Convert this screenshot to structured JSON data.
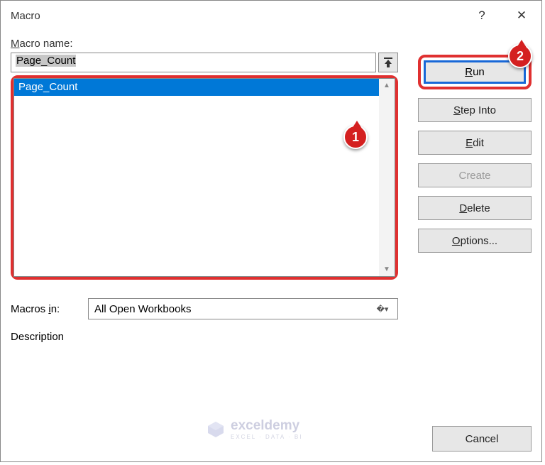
{
  "dialog": {
    "title": "Macro",
    "help_label": "?",
    "close_label": "✕"
  },
  "labels": {
    "macro_name_prefix": "M",
    "macro_name_rest": "acro name:",
    "macros_in_prefix": "Macros ",
    "macros_in_u": "i",
    "macros_in_rest": "n:",
    "description": "Description"
  },
  "input": {
    "value": "Page_Count"
  },
  "list": {
    "items": [
      "Page_Count"
    ]
  },
  "select": {
    "value": "All Open Workbooks"
  },
  "buttons": {
    "run_u": "R",
    "run_rest": "un",
    "stepinto_u": "S",
    "stepinto_rest": "tep Into",
    "edit_u": "E",
    "edit_rest": "dit",
    "create": "Create",
    "delete_u": "D",
    "delete_rest": "elete",
    "options_u": "O",
    "options_rest": "ptions...",
    "cancel": "Cancel"
  },
  "badges": {
    "b1": "1",
    "b2": "2"
  },
  "watermark": {
    "text": "exceldemy",
    "sub": "EXCEL · DATA · BI"
  }
}
